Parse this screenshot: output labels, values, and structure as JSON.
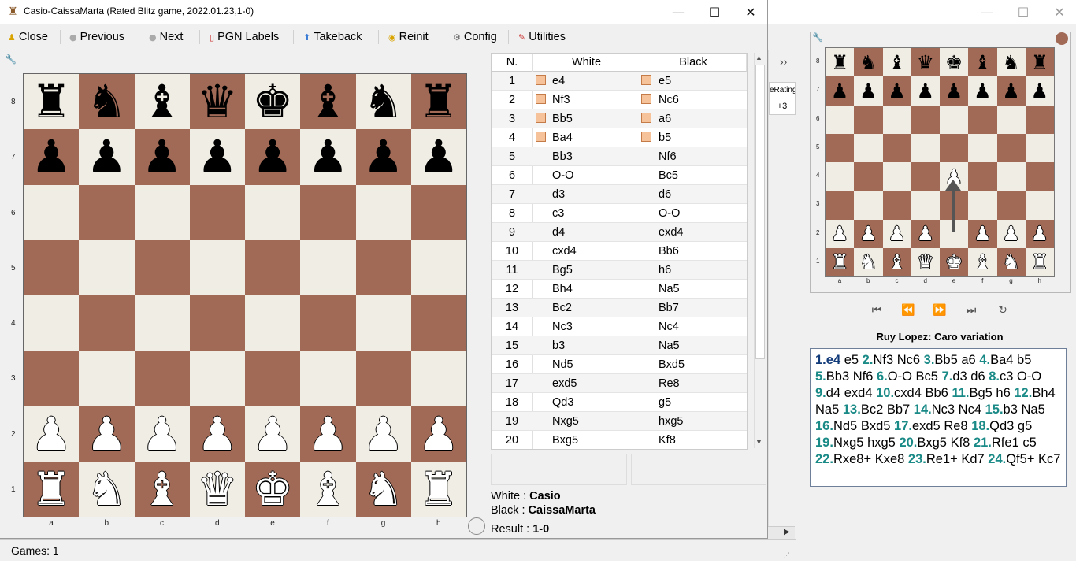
{
  "dialog": {
    "title": "Casio-CaissaMarta (Rated Blitz game, 2022.01.23,1-0)",
    "controls": {
      "minimize": "—",
      "maximize": "☐",
      "close": "✕"
    }
  },
  "toolbar": [
    {
      "icon": "close-icon",
      "label": "Close"
    },
    {
      "icon": "previous-icon",
      "label": "Previous"
    },
    {
      "icon": "next-icon",
      "label": "Next"
    },
    {
      "icon": "pgn-labels-icon",
      "label": "PGN Labels"
    },
    {
      "icon": "takeback-icon",
      "label": "Takeback"
    },
    {
      "icon": "reinit-icon",
      "label": "Reinit"
    },
    {
      "icon": "config-icon",
      "label": "Config"
    },
    {
      "icon": "utilities-icon",
      "label": "Utilities"
    }
  ],
  "board": {
    "ranks": [
      "8",
      "7",
      "6",
      "5",
      "4",
      "3",
      "2",
      "1"
    ],
    "files": [
      "a",
      "b",
      "c",
      "d",
      "e",
      "f",
      "g",
      "h"
    ],
    "position": [
      [
        "r",
        "n",
        "b",
        "q",
        "k",
        "b",
        "n",
        "r"
      ],
      [
        "p",
        "p",
        "p",
        "p",
        "p",
        "p",
        "p",
        "p"
      ],
      [
        "",
        "",
        "",
        "",
        "",
        "",
        "",
        ""
      ],
      [
        "",
        "",
        "",
        "",
        "",
        "",
        "",
        ""
      ],
      [
        "",
        "",
        "",
        "",
        "",
        "",
        "",
        ""
      ],
      [
        "",
        "",
        "",
        "",
        "",
        "",
        "",
        ""
      ],
      [
        "P",
        "P",
        "P",
        "P",
        "P",
        "P",
        "P",
        "P"
      ],
      [
        "R",
        "N",
        "B",
        "Q",
        "K",
        "B",
        "N",
        "R"
      ]
    ]
  },
  "moves_table": {
    "headers": {
      "n": "N.",
      "white": "White",
      "black": "Black"
    },
    "rows": [
      {
        "n": "1",
        "white": "e4",
        "black": "e5",
        "flag": true
      },
      {
        "n": "2",
        "white": "Nf3",
        "black": "Nc6",
        "flag": true
      },
      {
        "n": "3",
        "white": "Bb5",
        "black": "a6",
        "flag": true
      },
      {
        "n": "4",
        "white": "Ba4",
        "black": "b5",
        "flag": true
      },
      {
        "n": "5",
        "white": "Bb3",
        "black": "Nf6"
      },
      {
        "n": "6",
        "white": "O-O",
        "black": "Bc5"
      },
      {
        "n": "7",
        "white": "d3",
        "black": "d6"
      },
      {
        "n": "8",
        "white": "c3",
        "black": "O-O"
      },
      {
        "n": "9",
        "white": "d4",
        "black": "exd4"
      },
      {
        "n": "10",
        "white": "cxd4",
        "black": "Bb6"
      },
      {
        "n": "11",
        "white": "Bg5",
        "black": "h6"
      },
      {
        "n": "12",
        "white": "Bh4",
        "black": "Na5"
      },
      {
        "n": "13",
        "white": "Bc2",
        "black": "Bb7"
      },
      {
        "n": "14",
        "white": "Nc3",
        "black": "Nc4"
      },
      {
        "n": "15",
        "white": "b3",
        "black": "Na5"
      },
      {
        "n": "16",
        "white": "Nd5",
        "black": "Bxd5"
      },
      {
        "n": "17",
        "white": "exd5",
        "black": "Re8"
      },
      {
        "n": "18",
        "white": "Qd3",
        "black": "g5"
      },
      {
        "n": "19",
        "white": "Nxg5",
        "black": "hxg5"
      },
      {
        "n": "20",
        "white": "Bxg5",
        "black": "Kf8"
      }
    ]
  },
  "game_info": {
    "white_label": "White : ",
    "white": "Casio",
    "black_label": "Black : ",
    "black": "CaissaMarta",
    "result_label": "Result : ",
    "result": "1-0"
  },
  "status_bar": {
    "games": "Games: 1"
  },
  "main_window": {
    "controls": {
      "minimize": "—",
      "maximize": "☐",
      "close": "✕"
    },
    "side_column": {
      "header": "eRating",
      "value": "+3",
      "chevron": "››"
    },
    "mini_board": {
      "ranks": [
        "8",
        "7",
        "6",
        "5",
        "4",
        "3",
        "2",
        "1"
      ],
      "files": [
        "a",
        "b",
        "c",
        "d",
        "e",
        "f",
        "g",
        "h"
      ],
      "position": [
        [
          "r",
          "n",
          "b",
          "q",
          "k",
          "b",
          "n",
          "r"
        ],
        [
          "p",
          "p",
          "p",
          "p",
          "p",
          "p",
          "p",
          "p"
        ],
        [
          "",
          "",
          "",
          "",
          "",
          "",
          "",
          ""
        ],
        [
          "",
          "",
          "",
          "",
          "",
          "",
          "",
          ""
        ],
        [
          "",
          "",
          "",
          "",
          "P",
          "",
          "",
          ""
        ],
        [
          "",
          "",
          "",
          "",
          "",
          "",
          "",
          ""
        ],
        [
          "P",
          "P",
          "P",
          "P",
          "",
          "P",
          "P",
          "P"
        ],
        [
          "R",
          "N",
          "B",
          "Q",
          "K",
          "B",
          "N",
          "R"
        ]
      ]
    },
    "nav_buttons": [
      "⏮",
      "⏪",
      "⏩",
      "⏭",
      "↻"
    ],
    "opening": "Ruy Lopez: Caro variation",
    "notation": [
      {
        "num": "1.",
        "move": "e4 e5"
      },
      {
        "num": "2.",
        "move": "Nf3 Nc6"
      },
      {
        "num": "3.",
        "move": "Bb5 a6"
      },
      {
        "num": "4.",
        "move": "Ba4 b5"
      },
      {
        "num": "5.",
        "move": "Bb3 Nf6"
      },
      {
        "num": "6.",
        "move": "O-O Bc5"
      },
      {
        "num": "7.",
        "move": "d3 d6"
      },
      {
        "num": "8.",
        "move": "c3 O-O"
      },
      {
        "num": "9.",
        "move": "d4 exd4"
      },
      {
        "num": "10.",
        "move": "cxd4 Bb6"
      },
      {
        "num": "11.",
        "move": "Bg5 h6"
      },
      {
        "num": "12.",
        "move": "Bh4 Na5"
      },
      {
        "num": "13.",
        "move": "Bc2 Bb7"
      },
      {
        "num": "14.",
        "move": "Nc3 Nc4"
      },
      {
        "num": "15.",
        "move": "b3 Na5"
      },
      {
        "num": "16.",
        "move": "Nd5 Bxd5"
      },
      {
        "num": "17.",
        "move": "exd5 Re8"
      },
      {
        "num": "18.",
        "move": "Qd3 g5"
      },
      {
        "num": "19.",
        "move": "Nxg5 hxg5"
      },
      {
        "num": "20.",
        "move": "Bxg5 Kf8"
      },
      {
        "num": "21.",
        "move": "Rfe1 c5"
      },
      {
        "num": "22.",
        "move": "Rxe8+ Kxe8"
      },
      {
        "num": "23.",
        "move": "Re1+ Kd7"
      },
      {
        "num": "24.",
        "move": "Qf5+ Kc7"
      }
    ]
  },
  "colors": {
    "light_square": "#efede4",
    "dark_square": "#a16a57",
    "move_number": "#1a8a87",
    "current_move": "#123b7a"
  }
}
